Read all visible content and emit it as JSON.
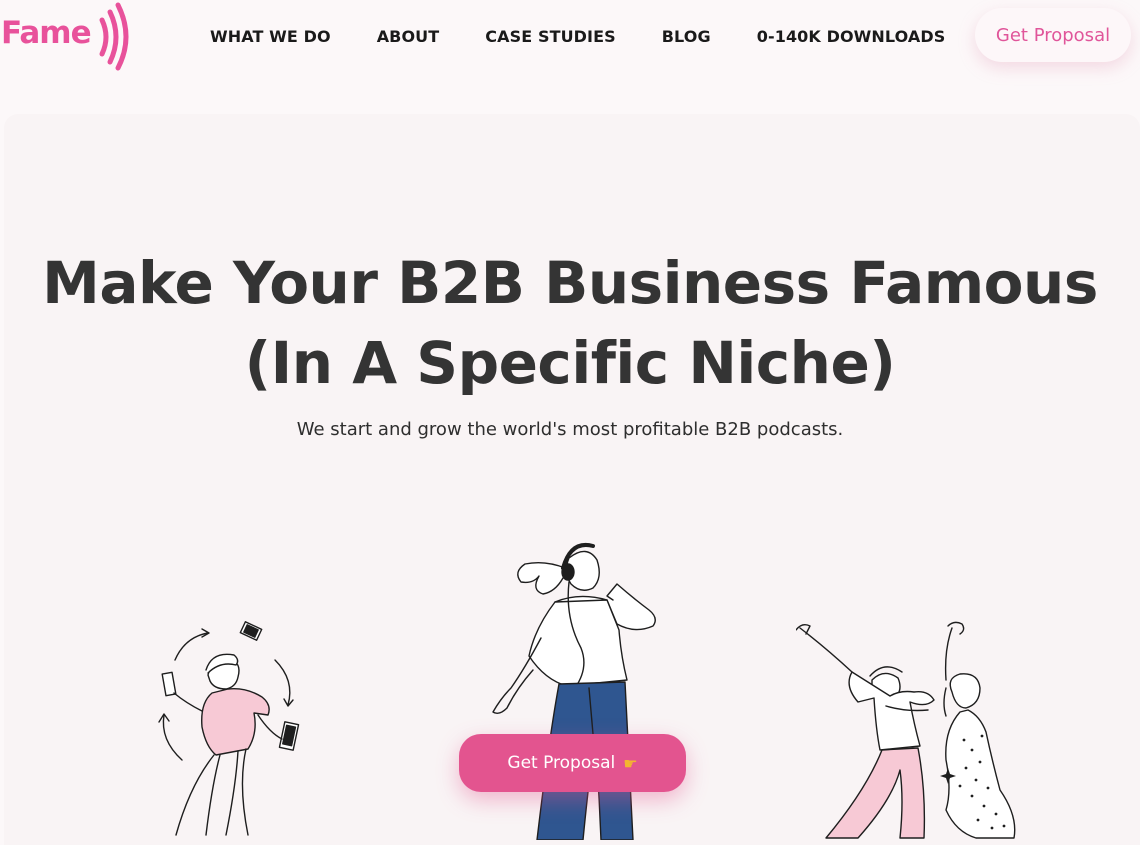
{
  "brand": {
    "name": "Fame",
    "color": "#e8529b"
  },
  "nav": {
    "items": [
      {
        "label": "WHAT WE DO"
      },
      {
        "label": "ABOUT"
      },
      {
        "label": "CASE STUDIES"
      },
      {
        "label": "BLOG"
      },
      {
        "label": "0-140K DOWNLOADS"
      }
    ],
    "cta_label": "Get Proposal"
  },
  "hero": {
    "title_line1": "Make Your B2B Business Famous",
    "title_line2": "(In A Specific Niche)",
    "subtitle": "We start and grow the world's most profitable B2B podcasts.",
    "cta_label": "Get Proposal",
    "cta_icon": "pointing-hand-icon",
    "cta_color": "#e3548f"
  },
  "illustrations": [
    {
      "name": "person-juggling-phones-illustration"
    },
    {
      "name": "woman-with-headphones-illustration"
    },
    {
      "name": "people-dancing-illustration"
    }
  ]
}
